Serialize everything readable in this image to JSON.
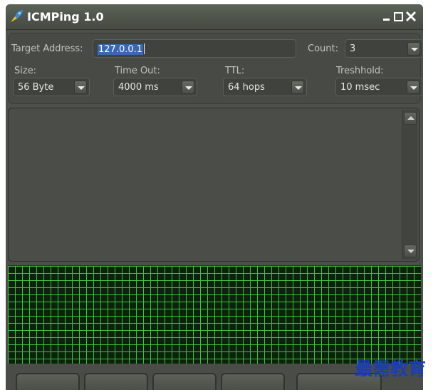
{
  "window": {
    "title": "ICMPing 1.0",
    "controls": {
      "minimize": "minimize-icon",
      "maximize": "maximize-icon",
      "close": "close-icon"
    }
  },
  "form": {
    "target_label": "Target Address:",
    "target_value": "127.0.0.1",
    "count_label": "Count:",
    "count_value": "3",
    "size_label": "Size:",
    "size_value": "56 Byte",
    "timeout_label": "Time Out:",
    "timeout_value": "4000 ms",
    "ttl_label": "TTL:",
    "ttl_value": "64 hops",
    "threshold_label": "Treshhold:",
    "threshold_value": "10 msec"
  },
  "watermark": {
    "text": "最需教育"
  },
  "colors": {
    "window_bg": "#4d5049",
    "graph_bg": "#0b220b",
    "graph_grid": "#3fc33f",
    "selection": "#3a67b0",
    "watermark": "#1a3db8"
  }
}
